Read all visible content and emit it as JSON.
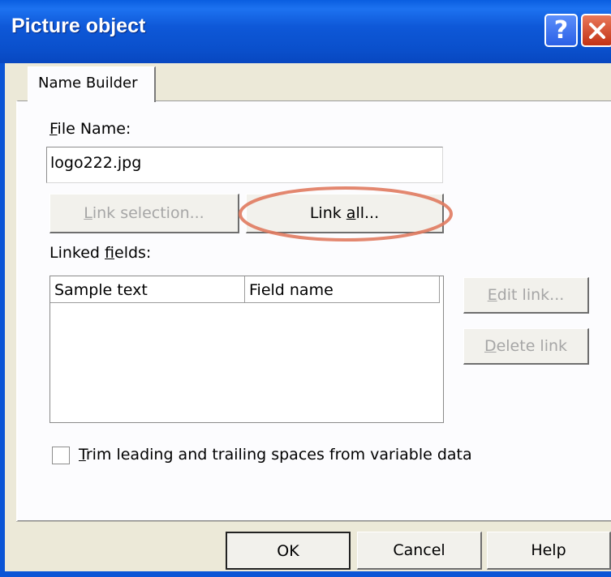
{
  "window": {
    "title": "Picture object",
    "help_glyph": "?",
    "close_icon": "close-icon"
  },
  "tabs": [
    {
      "label": "Name Builder",
      "selected": true
    }
  ],
  "file_name": {
    "label_first": "F",
    "label_rest": "ile Name:",
    "value": "logo222.jpg"
  },
  "buttons": {
    "link_selection": {
      "pre": "",
      "u": "L",
      "post": "ink selection...",
      "enabled": false
    },
    "link_all": {
      "pre": "Link ",
      "u": "a",
      "post": "ll...",
      "enabled": true,
      "highlighted": true,
      "highlight_color": "#e07a5f"
    },
    "edit_link": {
      "pre": "",
      "u": "E",
      "post": "dit link...",
      "enabled": false
    },
    "delete_link": {
      "pre": "",
      "u": "D",
      "post": "elete link",
      "enabled": false
    }
  },
  "linked_fields": {
    "label_pre": "Linked ",
    "label_u": "f",
    "label_post": "ields:",
    "columns": [
      "Sample text",
      "Field name"
    ],
    "rows": []
  },
  "trim_option": {
    "u": "T",
    "rest": "rim leading and trailing spaces from variable data",
    "checked": false
  },
  "footer": {
    "ok": "OK",
    "cancel": "Cancel",
    "help": "Help"
  },
  "colors": {
    "titlebar": "#0a54d8",
    "dialog_bg": "#ece9d8",
    "panel_bg": "#fcfcfe",
    "close_button": "#d2401d",
    "disabled_text": "#a6a6a6"
  }
}
